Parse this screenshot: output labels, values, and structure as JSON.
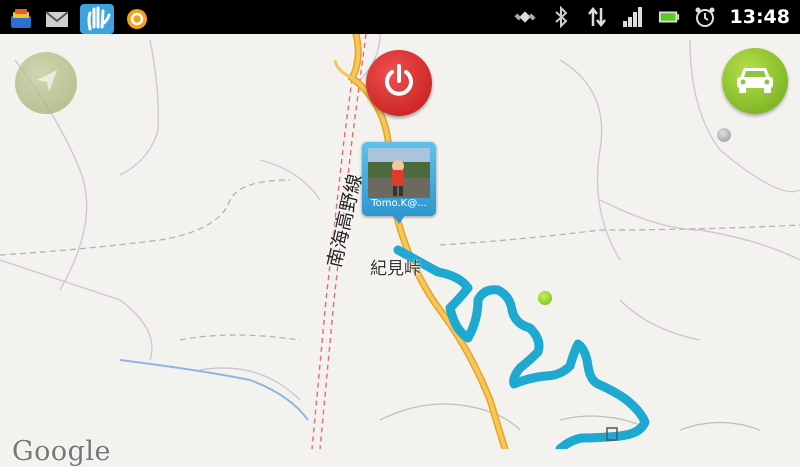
{
  "status_bar": {
    "app_icons": [
      "stack-app-icon",
      "mail-icon",
      "hi-app-icon",
      "orange-app-icon"
    ],
    "status_icons": [
      "gps-satellite-icon",
      "bluetooth-icon",
      "data-transfer-icon",
      "signal-strength-icon",
      "battery-icon",
      "alarm-clock-icon"
    ],
    "time": "13:48"
  },
  "map": {
    "railway_label": "南海高野線",
    "place_label": "紀見峠",
    "watermark": "Google",
    "route_color": "#1ea9d1",
    "road_color": "#f0b83c"
  },
  "marker": {
    "caption": "Tomo.K@..."
  },
  "buttons": {
    "compass": "compass-icon",
    "power": "power-icon",
    "car": "car-icon"
  }
}
